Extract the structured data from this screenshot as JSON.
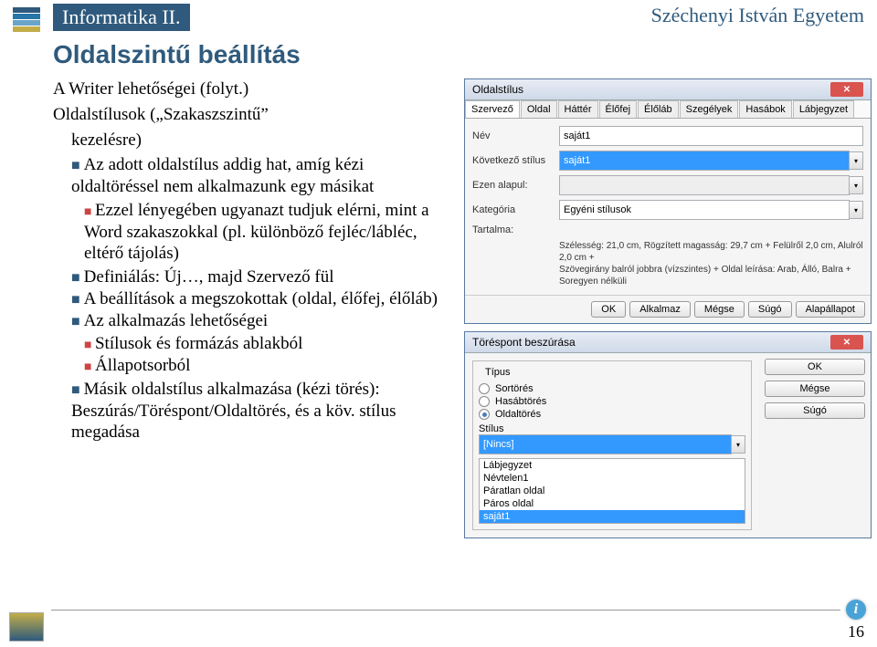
{
  "header": {
    "course": "Informatika II.",
    "university": "Széchenyi István Egyetem"
  },
  "section_title": "Oldalszintű beállítás",
  "body": {
    "lead": "A Writer lehetőségei (folyt.)",
    "para2a": "Oldalstílusok („Szakaszszintű”",
    "para2b": "kezelésre)",
    "b1": "Az adott oldalstílus addig hat, amíg kézi oldaltöréssel nem alkalmazunk egy másikat",
    "b1a": "Ezzel lényegében ugyanazt tudjuk elérni, mint a Word szakaszokkal (pl. különböző fejléc/lábléc, eltérő tájolás)",
    "b2": "Definiálás: Új…, majd Szervező fül",
    "b3": "A beállítások a megszokottak (oldal, élőfej, élőláb)",
    "b4": "Az alkalmazás lehetőségei",
    "b4a": "Stílusok és formázás ablakból",
    "b4b": "Állapotsorból",
    "b5": "Másik oldalstílus alkalmazása (kézi törés): Beszúrás/Töréspont/Oldaltörés, és a köv. stílus megadása"
  },
  "dialog1": {
    "title": "Oldalstílus",
    "tabs": [
      "Szervező",
      "Oldal",
      "Háttér",
      "Élőfej",
      "Élőláb",
      "Szegélyek",
      "Hasábok",
      "Lábjegyzet"
    ],
    "rows": {
      "name_lbl": "Név",
      "name_val": "saját1",
      "next_lbl": "Következő stílus",
      "next_val": "saját1",
      "base_lbl": "Ezen alapul:",
      "base_val": "",
      "cat_lbl": "Kategória",
      "cat_val": "Egyéni stílusok",
      "content_lbl": "Tartalma:"
    },
    "desc1": "Szélesség: 21,0 cm, Rögzített magasság: 29,7 cm + Felülről 2,0 cm, Alulról 2,0 cm +",
    "desc2": "Szövegirány balról jobbra (vízszintes) + Oldal leírása: Arab, Álló, Balra + Soregyen nélküli",
    "buttons": {
      "ok": "OK",
      "apply": "Alkalmaz",
      "cancel": "Mégse",
      "help": "Súgó",
      "reset": "Alapállapot"
    }
  },
  "dialog2": {
    "title": "Töréspont beszúrása",
    "type_lbl": "Típus",
    "r1": "Sortörés",
    "r2": "Hasábtörés",
    "r3": "Oldaltörés",
    "style_lbl": "Stílus",
    "items": [
      "[Nincs]",
      "Lábjegyzet",
      "Névtelen1",
      "Páratlan oldal",
      "Páros oldal",
      "saját1"
    ],
    "selected": "saját1",
    "buttons": {
      "ok": "OK",
      "cancel": "Mégse",
      "help": "Súgó"
    }
  },
  "page_number": "16"
}
